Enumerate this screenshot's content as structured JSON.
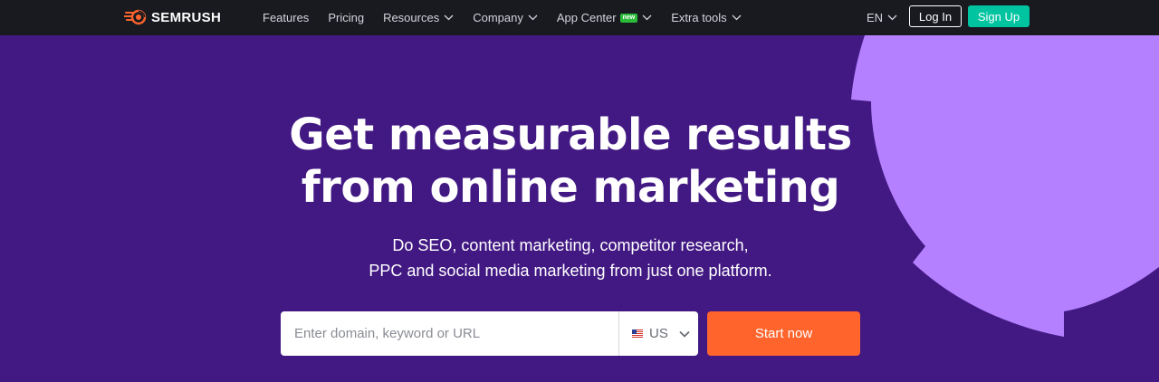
{
  "brand": {
    "name": "SEMRUSH",
    "accent": "#ff642d"
  },
  "nav": {
    "items": [
      {
        "label": "Features",
        "has_dropdown": false
      },
      {
        "label": "Pricing",
        "has_dropdown": false
      },
      {
        "label": "Resources",
        "has_dropdown": true
      },
      {
        "label": "Company",
        "has_dropdown": true
      },
      {
        "label": "App Center",
        "has_dropdown": true,
        "badge": "new"
      },
      {
        "label": "Extra tools",
        "has_dropdown": true
      }
    ],
    "language": "EN",
    "login_label": "Log In",
    "signup_label": "Sign Up"
  },
  "hero": {
    "title_line1": "Get measurable results",
    "title_line2": "from online marketing",
    "subtitle_line1": "Do SEO, content marketing, competitor research,",
    "subtitle_line2": "PPC and social media marketing from just one platform."
  },
  "search": {
    "placeholder": "Enter domain, keyword or URL",
    "value": "",
    "country": "US",
    "start_label": "Start now"
  },
  "colors": {
    "topbar": "#181a1f",
    "hero_bg": "#421983",
    "blob": "#b580ff",
    "signup": "#00c4a0",
    "start": "#ff642d",
    "new_badge": "#2bba3a"
  }
}
